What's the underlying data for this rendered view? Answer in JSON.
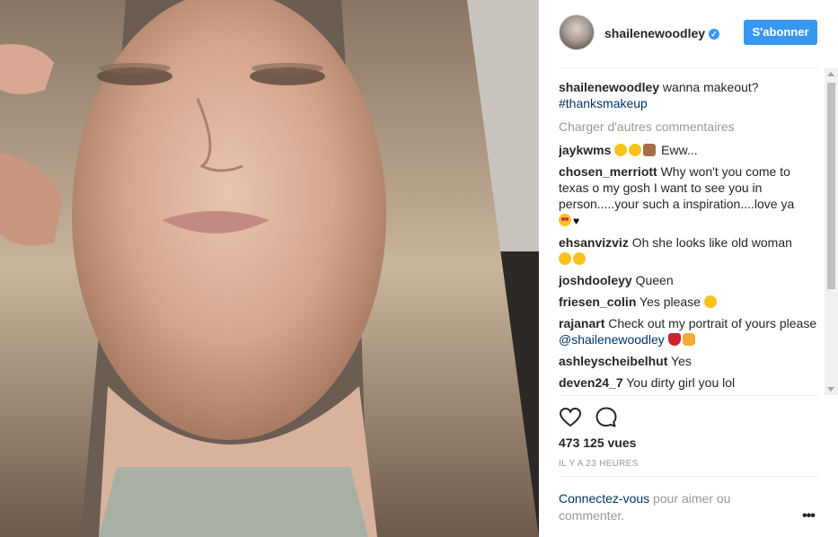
{
  "post": {
    "username": "shailenewoodley",
    "verified": true,
    "follow_label": "S'abonner",
    "caption_user": "shailenewoodley",
    "caption_text": " wanna makeout?",
    "caption_hashtag": "#thanksmakeup",
    "load_more_label": "Charger d'autres commentaires",
    "views": "473 125 vues",
    "timestamp": "IL Y A 23 HEURES",
    "login_link": "Connectez-vous",
    "login_text": " pour aimer ou commenter.",
    "more_label": "•••"
  },
  "comments": [
    {
      "user": "jaykwms",
      "text": " Eww...",
      "emojis": [
        "face-emoji",
        "face-emoji",
        "thumbs-up-emoji"
      ]
    },
    {
      "user": "chosen_merriott",
      "text": " Why won't you come to texas o my gosh I want to see you in person.....your such a inspiration....love ya",
      "tail": "♥"
    },
    {
      "user": "ehsanvizviz",
      "text": " Oh she looks like old woman"
    },
    {
      "user": "joshdooleyy",
      "text": " Queen"
    },
    {
      "user": "friesen_colin",
      "text": " Yes please "
    },
    {
      "user": "rajanart",
      "text": " Check out my portrait of yours please ",
      "mention": "@shailenewoodley"
    },
    {
      "user": "ashleyscheibelhut",
      "text": " Yes"
    },
    {
      "user": "deven24_7",
      "text": " You dirty girl you lol"
    }
  ],
  "colors": {
    "accent": "#3897f0",
    "link": "#003569",
    "muted": "#999999"
  },
  "icons": [
    "verified-badge-icon",
    "heart-icon",
    "comment-bubble-icon",
    "more-dots-icon"
  ]
}
